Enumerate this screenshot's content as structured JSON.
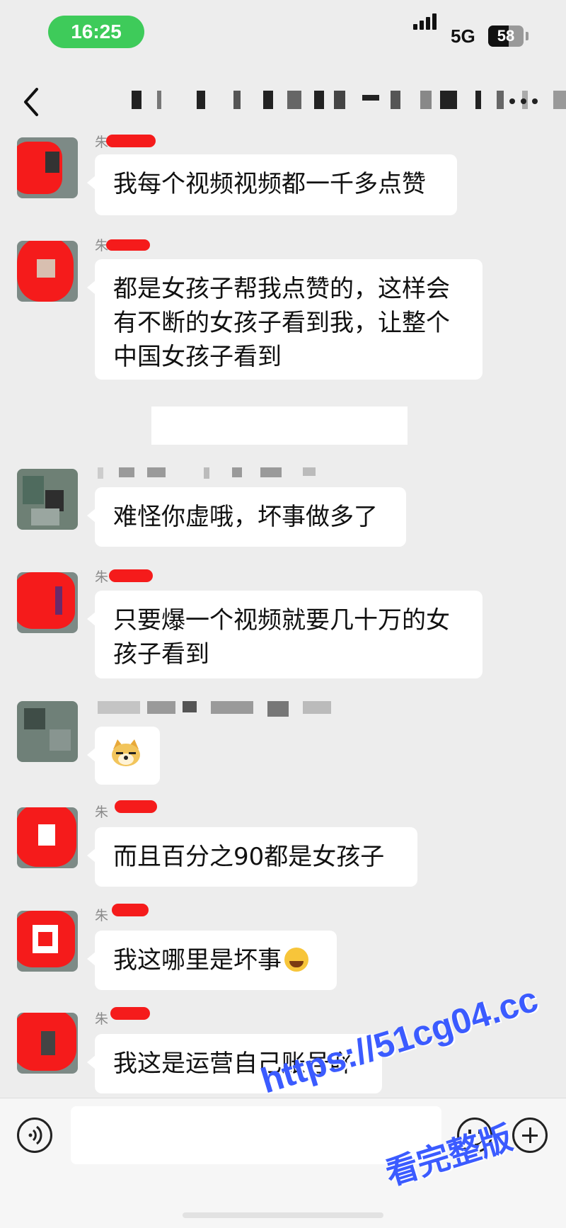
{
  "status_bar": {
    "time": "16:25",
    "network": "5G",
    "battery": "58"
  },
  "messages": [
    {
      "sender": "朱",
      "text": "我每个视频视频都一千多点赞"
    },
    {
      "sender": "朱",
      "text": "都是女孩子帮我点赞的，这样会有不断的女孩子看到我，让整个中国女孩子看到"
    },
    {
      "sender": "",
      "text": "难怪你虚哦，坏事做多了"
    },
    {
      "sender": "朱",
      "text": "只要爆一个视频就要几十万的女孩子看到"
    },
    {
      "sender": "",
      "text": "",
      "emoji": "doge-emoji"
    },
    {
      "sender": "朱",
      "text": "而且百分之90都是女孩子"
    },
    {
      "sender": "朱",
      "text": "我这哪里是坏事",
      "emoji": "tears-of-joy-emoji"
    },
    {
      "sender": "朱",
      "text": "我这是运营自己账号吖"
    }
  ],
  "watermark": {
    "url": "https://51cg04.cc",
    "caption": "看完整版"
  },
  "colors": {
    "time_pill": "#3ecb5a",
    "redaction": "#f51b1b",
    "watermark": "#3b5bff",
    "background": "#ededed"
  }
}
